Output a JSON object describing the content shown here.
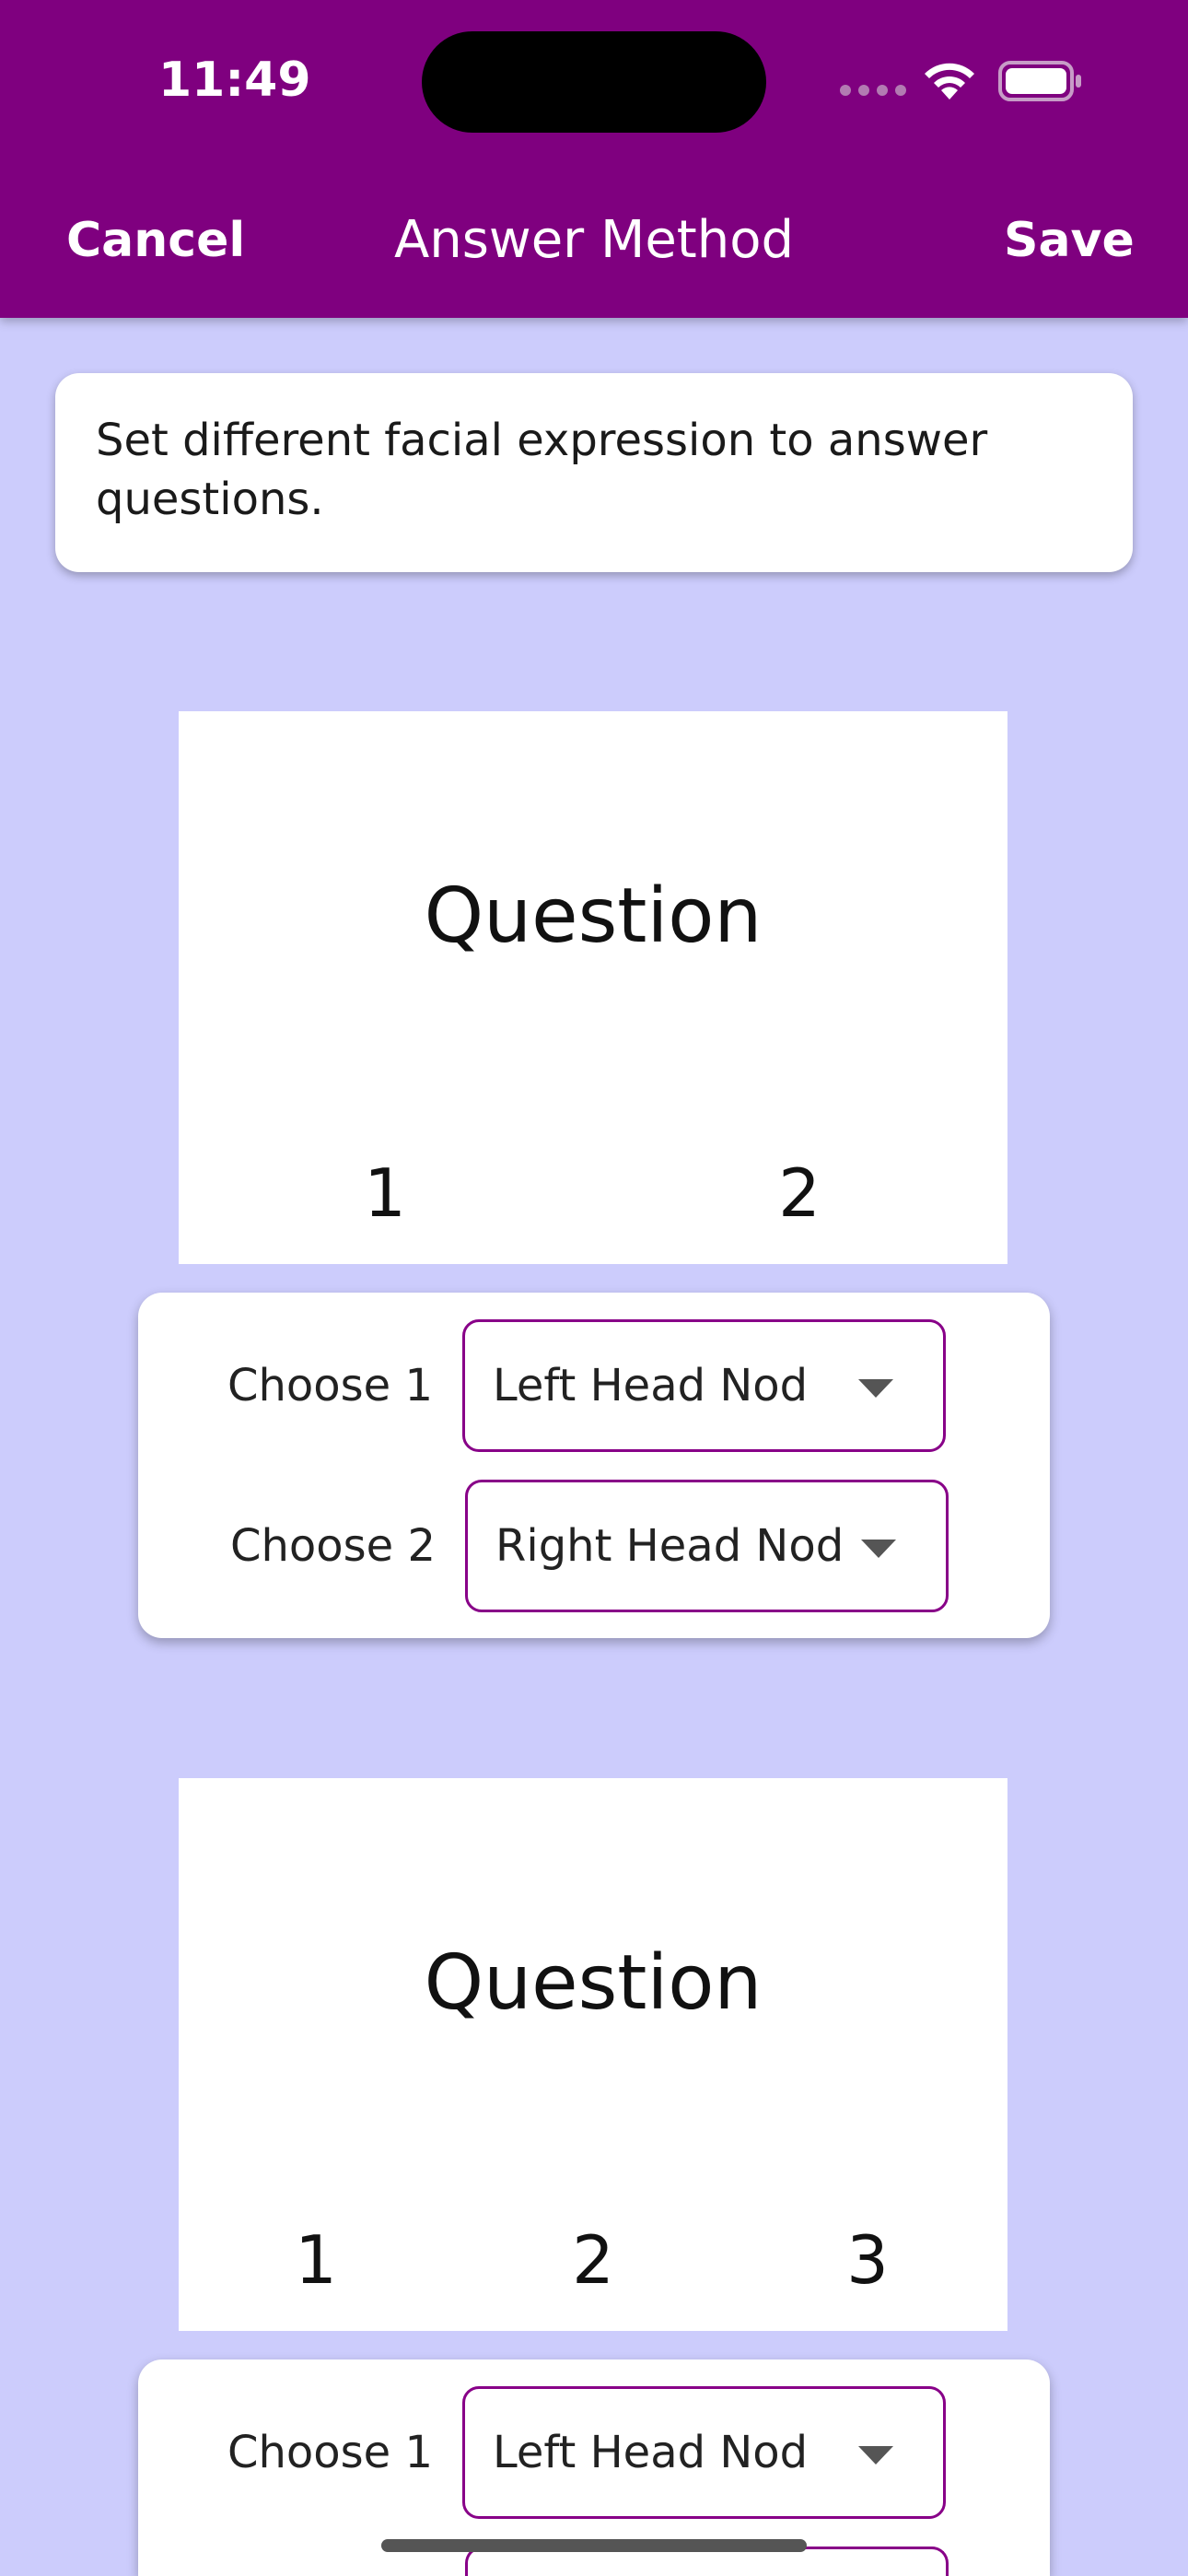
{
  "status_bar": {
    "time": "11:49"
  },
  "nav": {
    "cancel": "Cancel",
    "title": "Answer Method",
    "save": "Save"
  },
  "description": "Set different facial expression to answer questions.",
  "sections": [
    {
      "question": "Question",
      "options": [
        "1",
        "2"
      ],
      "choices": [
        {
          "label": "Choose 1",
          "value": "Left Head Nod"
        },
        {
          "label": "Choose 2",
          "value": "Right Head Nod"
        }
      ]
    },
    {
      "question": "Question",
      "options": [
        "1",
        "2",
        "3"
      ],
      "choices": [
        {
          "label": "Choose 1",
          "value": "Left Head Nod"
        }
      ]
    }
  ],
  "colors": {
    "header": "#7f007f",
    "background": "#ccccfc",
    "dropdown_border": "#880088"
  }
}
